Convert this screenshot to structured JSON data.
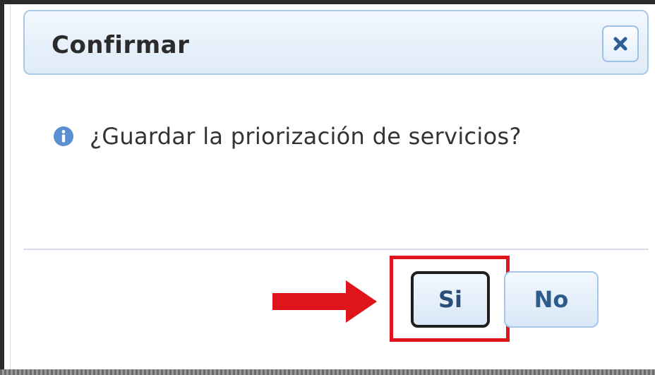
{
  "dialog": {
    "title": "Confirmar",
    "close_icon": "close-icon",
    "message_icon": "info-icon",
    "message": "¿Guardar la priorización de servicios?",
    "buttons": {
      "yes_label": "Si",
      "no_label": "No"
    }
  },
  "annotation": {
    "arrow_icon": "arrow-right-icon",
    "highlight_color": "#e0141b"
  },
  "colors": {
    "titlebar_border": "#a8c8ea",
    "button_text": "#2e5d8c",
    "info_icon": "#5b8fd1"
  }
}
